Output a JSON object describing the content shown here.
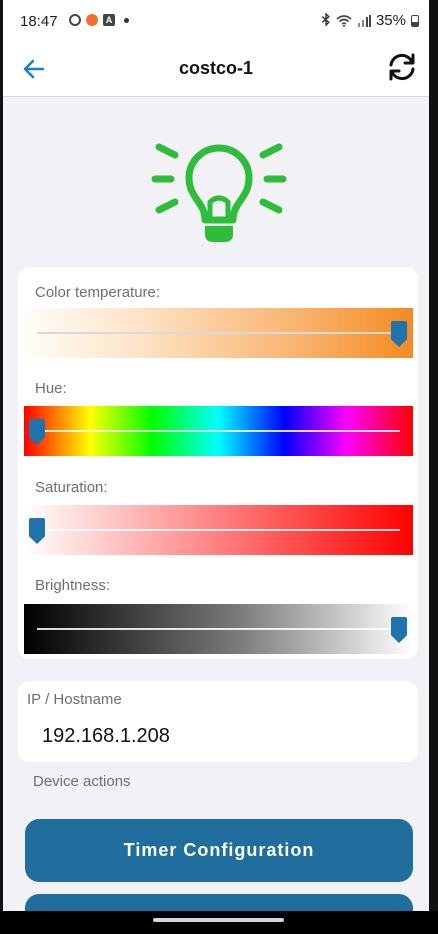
{
  "status_bar": {
    "time": "18:47",
    "notification_icons": [
      "chrome-icon",
      "firefox-icon",
      "a-icon"
    ],
    "battery": "35%",
    "system_icons": [
      "bluetooth-icon",
      "wifi-icon",
      "signal-icon",
      "battery-icon"
    ]
  },
  "nav": {
    "title": "costco-1",
    "back_icon": "back-arrow-icon",
    "refresh_icon": "refresh-icon"
  },
  "device": {
    "icon": "lightbulb-icon",
    "icon_color": "#2ebd3a"
  },
  "sliders": [
    {
      "label": "Color temperature:",
      "value": 1.0,
      "track": "color-temperature"
    },
    {
      "label": "Hue:",
      "value": 0.0,
      "track": "hue"
    },
    {
      "label": "Saturation:",
      "value": 0.0,
      "track": "saturation"
    },
    {
      "label": "Brightness:",
      "value": 1.0,
      "track": "brightness"
    }
  ],
  "ip": {
    "label": "IP / Hostname",
    "value": "192.168.1.208"
  },
  "actions": {
    "section_label": "Device actions",
    "buttons": [
      {
        "label": "Timer Configuration"
      },
      {
        "label": ""
      }
    ]
  },
  "colors": {
    "accent": "#1f6e9e",
    "thumb": "#2173ab",
    "back_arrow": "#1a7fd4"
  }
}
